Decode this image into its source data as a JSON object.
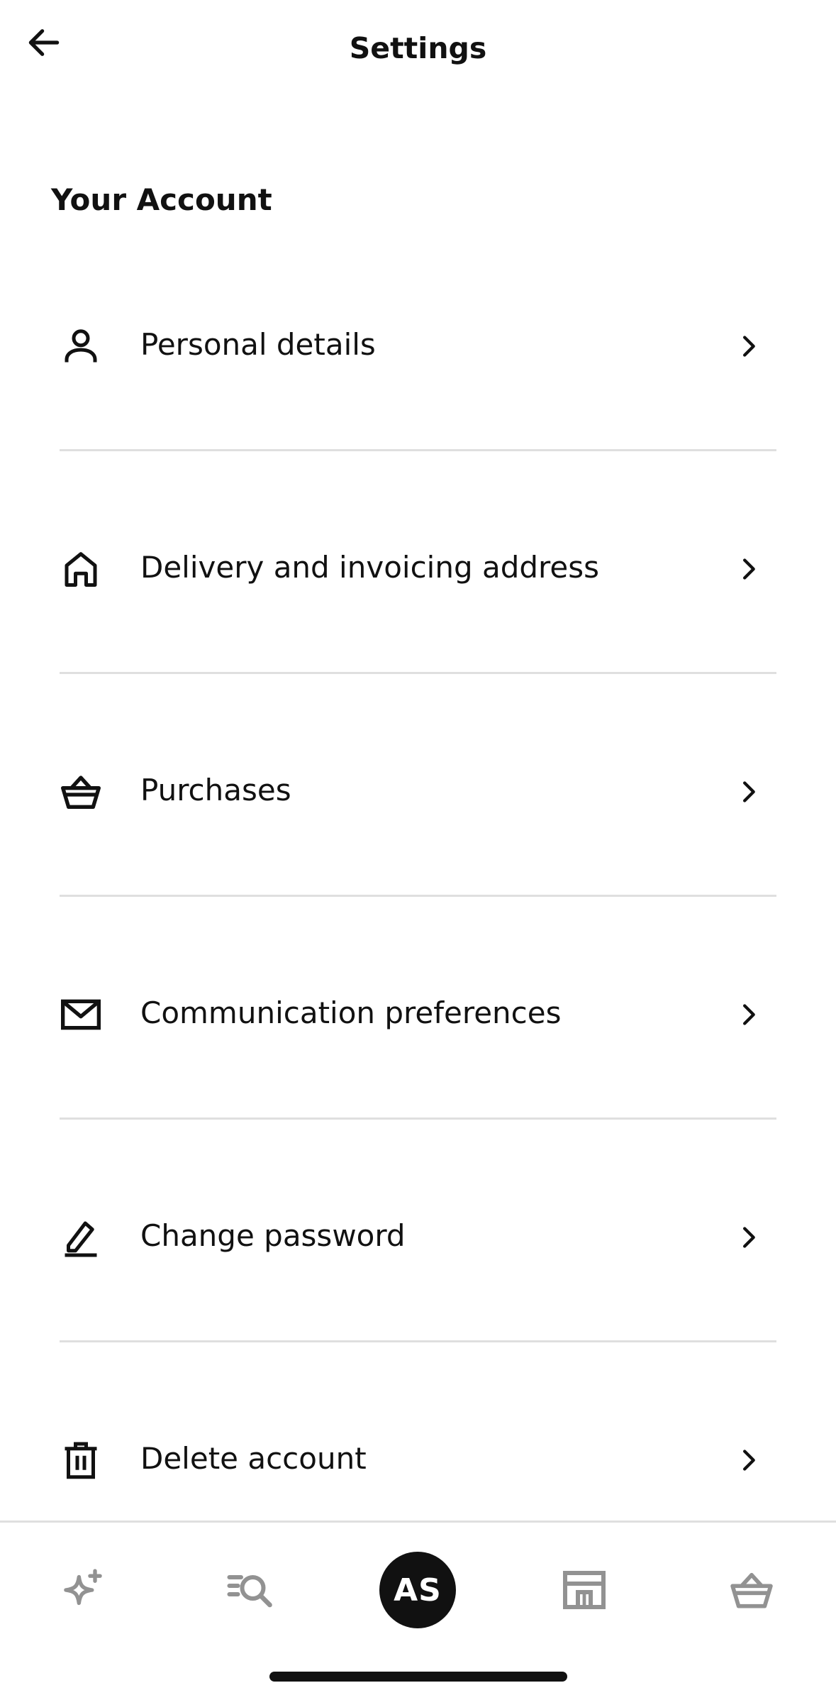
{
  "header": {
    "title": "Settings",
    "back_icon": "arrow-left-icon"
  },
  "section": {
    "title": "Your Account"
  },
  "items": [
    {
      "label": "Personal details",
      "icon": "person-icon"
    },
    {
      "label": "Delivery and invoicing address",
      "icon": "home-icon"
    },
    {
      "label": "Purchases",
      "icon": "basket-icon"
    },
    {
      "label": "Communication preferences",
      "icon": "envelope-icon"
    },
    {
      "label": "Change password",
      "icon": "pencil-icon"
    },
    {
      "label": "Delete account",
      "icon": "trash-icon"
    }
  ],
  "bottom_nav": {
    "items": [
      {
        "icon": "sparkle-icon"
      },
      {
        "icon": "search-icon"
      },
      {
        "avatar_initials": "AS"
      },
      {
        "icon": "store-icon"
      },
      {
        "icon": "basket-icon"
      }
    ]
  },
  "colors": {
    "text": "#111111",
    "divider": "#dfdfdf",
    "nav_inactive": "#929292",
    "avatar_bg": "#111111"
  }
}
